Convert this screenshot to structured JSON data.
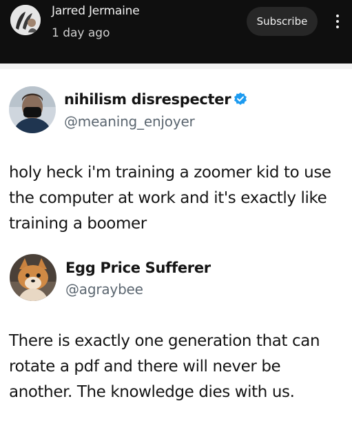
{
  "channel_post": {
    "author": "Jarred Jermaine",
    "time": "1 day ago",
    "subscribe_label": "Subscribe",
    "more_icon": "vertical-ellipsis-icon"
  },
  "tweets": [
    {
      "display_name": "nihilism disrespecter",
      "handle": "@meaning_enjoyer",
      "verified": true,
      "text_lines": [
        "holy heck i'm training a zoomer kid to use",
        "the computer at work and it's exactly like",
        "training a boomer"
      ]
    },
    {
      "display_name": "Egg Price Sufferer",
      "handle": "@agraybee",
      "verified": false,
      "text_lines": [
        "There is exactly one generation that can",
        "rotate a pdf and there will never be",
        "another. The knowledge dies with us."
      ]
    }
  ],
  "colors": {
    "topbar_bg": "#0f0f0f",
    "subscribe_bg": "#272727",
    "verified_blue": "#1d9bf0",
    "handle_gray": "#5b6670"
  }
}
